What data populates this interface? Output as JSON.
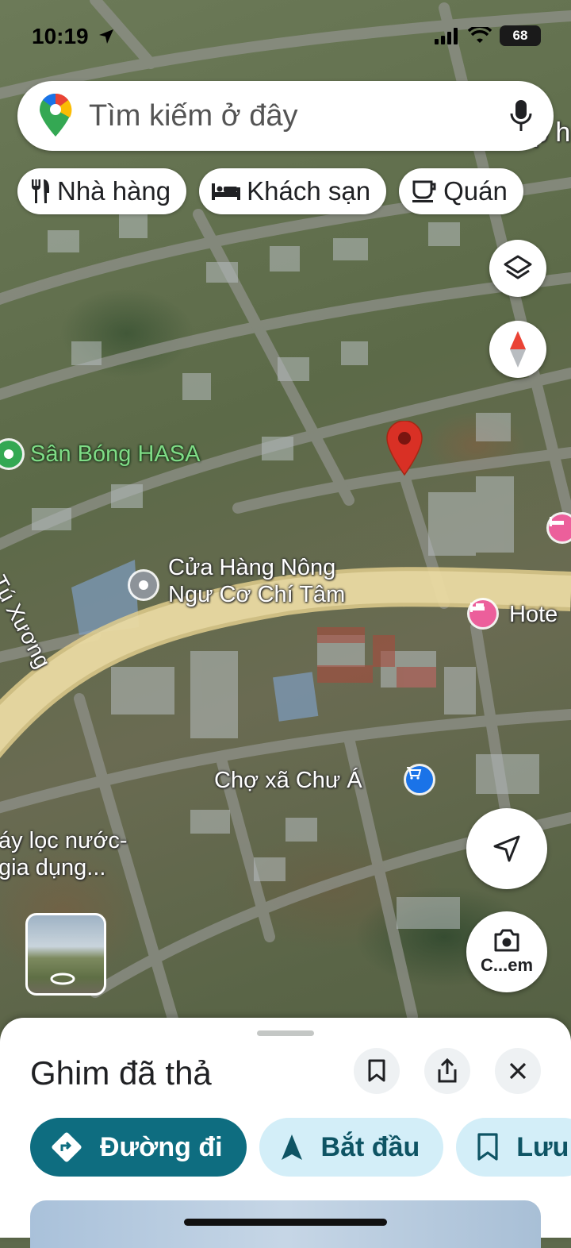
{
  "status_bar": {
    "time": "10:19",
    "battery": "68"
  },
  "search": {
    "placeholder": "Tìm kiếm ở đây"
  },
  "chips": [
    {
      "label": "Nhà hàng",
      "icon": "restaurant-icon"
    },
    {
      "label": "Khách sạn",
      "icon": "hotel-icon"
    },
    {
      "label": "Quán",
      "icon": "coffee-icon"
    }
  ],
  "map": {
    "labels": {
      "san_bong": "Sân Bóng HASA",
      "street_tu_xuong": "Tú Xương",
      "cua_hang_line1": "Cửa Hàng Nông",
      "cua_hang_line2": "Ngư Cơ Chí Tâm",
      "hotel": "Hote",
      "cho": "Chợ xã Chư Á",
      "may_loc_line1": "áy lọc nước-",
      "may_loc_line2": "gia dụng...",
      "top_right_fragment": "p h"
    },
    "pin_icon": "dropped-pin-icon",
    "camera_label": "C...em"
  },
  "sheet": {
    "title": "Ghim đã thả",
    "actions": {
      "directions": "Đường đi",
      "start": "Bắt đầu",
      "save": "Lưu"
    }
  },
  "colors": {
    "accent": "#0e6d80",
    "tonal": "#d3eef8",
    "pin": "#d93025",
    "poi_green": "#34a853",
    "poi_pink": "#ec5f9b",
    "poi_blue": "#1a73e8"
  }
}
